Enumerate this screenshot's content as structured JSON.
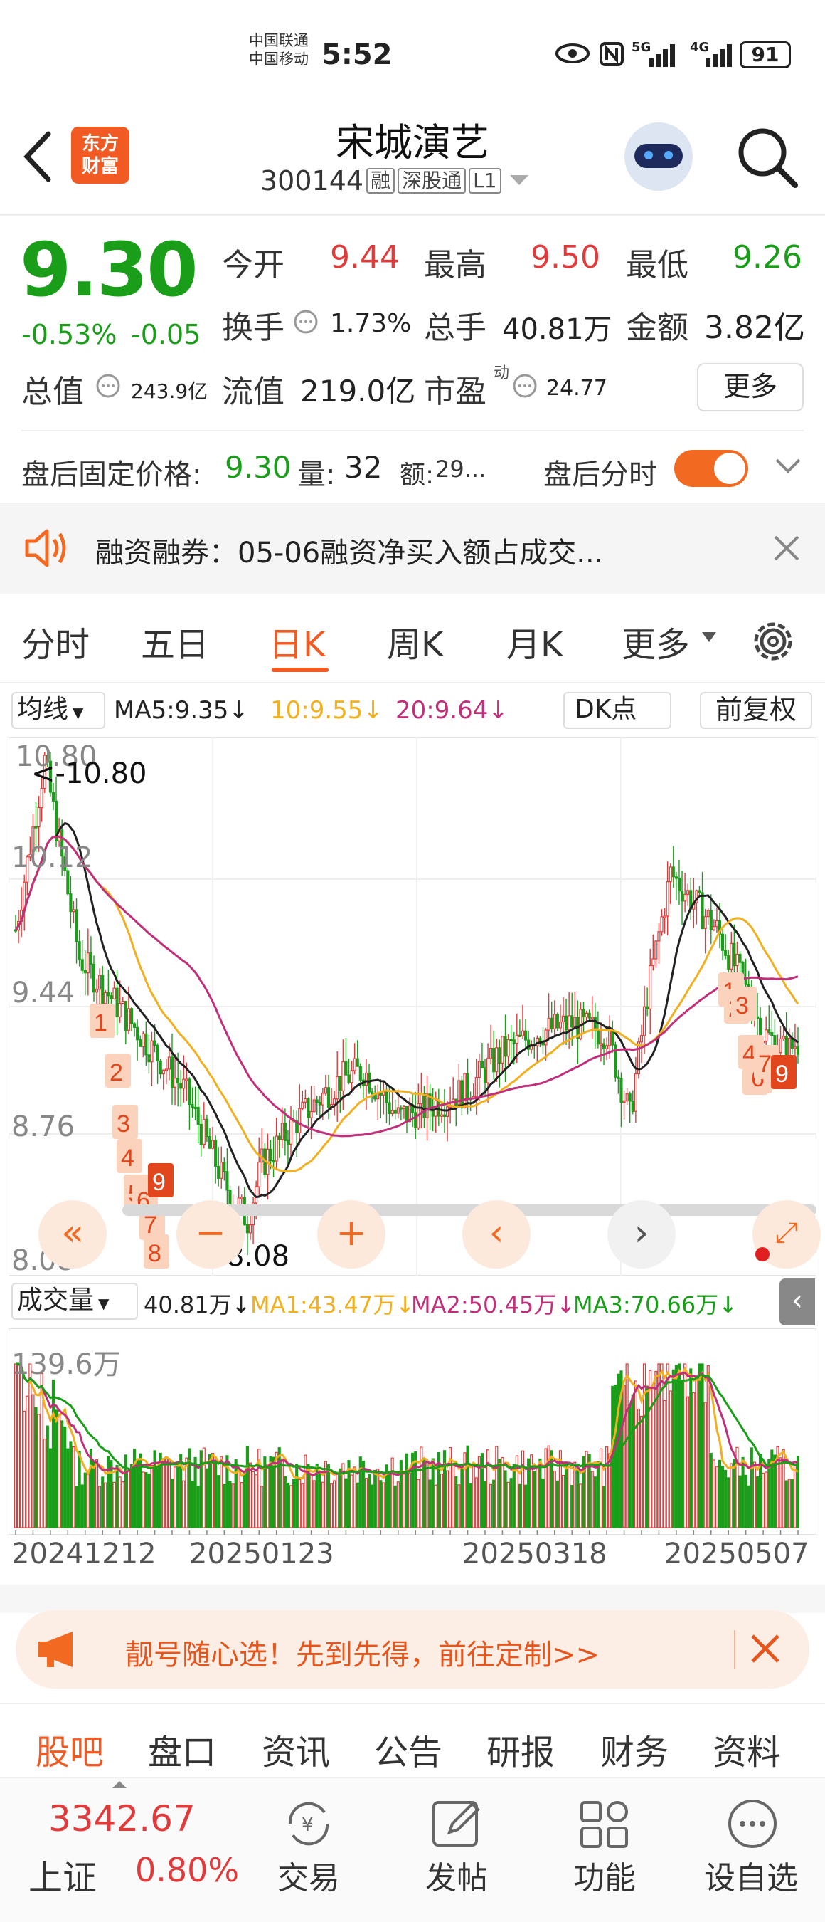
{
  "status_bar": {
    "carrier1": "中国联通",
    "carrier2": "中国移动",
    "time": "5:52",
    "signal1": "5G",
    "signal2": "4G",
    "battery": "91"
  },
  "header": {
    "title": "宋城演艺",
    "code": "300144",
    "tags": [
      "融",
      "深股通",
      "L1"
    ],
    "logo_text": "东方财富"
  },
  "quote": {
    "price": "9.30",
    "change_pct": "-0.53%",
    "change": "-0.05",
    "open_label": "今开",
    "open": "9.44",
    "high_label": "最高",
    "high": "9.50",
    "low_label": "最低",
    "low": "9.26",
    "turnover_label": "换手",
    "turnover": "1.73%",
    "volume_label": "总手",
    "volume": "40.81万",
    "amount_label": "金额",
    "amount": "3.82亿",
    "mktcap_label": "总值",
    "mktcap": "243.9亿",
    "float_label": "流值",
    "float_cap": "219.0亿",
    "pe_label": "市盈",
    "pe_sup": "动",
    "pe": "24.77",
    "more_label": "更多"
  },
  "after_hours": {
    "label": "盘后固定价格:",
    "price": "9.30",
    "vol_label": "量:",
    "vol": "32",
    "amt_label": "额:",
    "amt": "29...",
    "toggle_label": "盘后分时"
  },
  "notice": {
    "text": "融资融券：05-06融资净买入额占成交..."
  },
  "tabs": {
    "items": [
      "分时",
      "五日",
      "日K",
      "周K",
      "月K",
      "更多"
    ],
    "active": "日K"
  },
  "kline": {
    "ma_selector": "均线",
    "ma5": "MA5:9.35↓",
    "ma10": "10:9.55↓",
    "ma20": "20:9.64↓",
    "dk_label": "DK点",
    "adj_label": "前复权",
    "y_labels": [
      "10.80",
      "10.12",
      "9.44",
      "8.76",
      "8.08"
    ],
    "high_marker": "<-10.80",
    "low_marker": "<-8.08",
    "vol_selector": "成交量",
    "vol_val": "40.81万↓",
    "vol_ma1": "MA1:43.47万↓",
    "vol_ma2": "MA2:50.45万↓",
    "vol_ma3": "MA3:70.66万↓",
    "vol_max": "139.6万",
    "dates": [
      "20241212",
      "20250123",
      "20250318",
      "20250507"
    ],
    "td_labels": [
      "1",
      "2",
      "3",
      "4",
      "5",
      "6",
      "7",
      "8",
      "9",
      "1",
      "2",
      "3",
      "4",
      "5",
      "6",
      "7",
      "9"
    ]
  },
  "colors": {
    "up": "#e03a3a",
    "down": "#1a9e1a",
    "accent": "#f15a22",
    "ma5": "#222222",
    "ma10": "#f0b020",
    "ma20": "#c0307a"
  },
  "chart_data": {
    "type": "candlestick",
    "ylim": [
      8.08,
      10.8
    ],
    "high": 10.8,
    "low": 8.08,
    "ma_values": {
      "MA5": 9.35,
      "MA10": 9.55,
      "MA20": 9.64
    },
    "volume": {
      "last": "40.81万",
      "MA1": "43.47万",
      "MA2": "50.45万",
      "MA3": "70.66万",
      "max": "139.6万"
    }
  },
  "promo": {
    "text": "靓号随心选！先到先得，前往定制>>"
  },
  "sub_tabs": {
    "items": [
      "股吧",
      "盘口",
      "资讯",
      "公告",
      "研报",
      "财务",
      "资料"
    ],
    "active": "股吧"
  },
  "bottom_nav": {
    "index_value": "3342.67",
    "index_name": "上证",
    "index_pct": "0.80%",
    "items": [
      "交易",
      "发帖",
      "功能",
      "设自选"
    ]
  }
}
